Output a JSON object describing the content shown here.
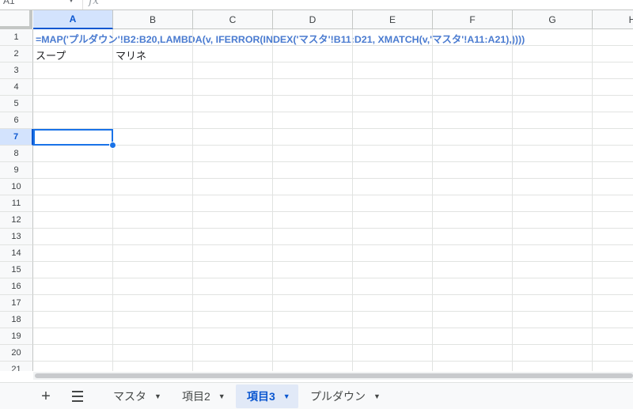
{
  "formula_bar": {
    "name_box": "A1",
    "fx_symbol": "fx"
  },
  "columns": [
    "A",
    "B",
    "C",
    "D",
    "E",
    "F",
    "G",
    "H"
  ],
  "selected_column": "A",
  "rows": [
    "1",
    "2",
    "3",
    "4",
    "5",
    "6",
    "7",
    "8",
    "9",
    "10",
    "11",
    "12",
    "13",
    "14",
    "15",
    "16",
    "17",
    "18",
    "19",
    "20",
    "21"
  ],
  "selected_row": "7",
  "cells": {
    "A1": "=MAP('プルダウン'!B2:B20,LAMBDA(v, IFERROR(INDEX('マスタ'!B11:D21, XMATCH(v,'マスタ'!A11:A21),))))",
    "A2": "スープ",
    "B2": "マリネ"
  },
  "active_cell": "A7",
  "sheet_tabs": [
    {
      "label": "マスタ",
      "active": false
    },
    {
      "label": "項目2",
      "active": false
    },
    {
      "label": "項目3",
      "active": true
    },
    {
      "label": "プルダウン",
      "active": false
    }
  ],
  "tab_controls": {
    "add_sheet": "+",
    "all_sheets_icon": "menu-icon"
  },
  "colors": {
    "selection": "#1a73e8",
    "formula_text": "#4a7bd0",
    "active_tab_bg": "#e1e9f7"
  }
}
